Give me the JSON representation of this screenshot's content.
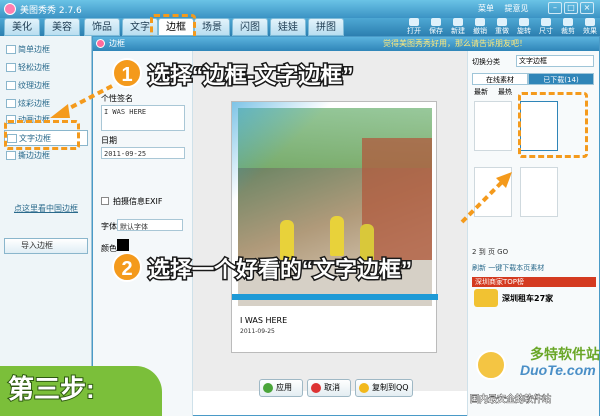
{
  "app": {
    "title": "美图秀秀 2.7.6",
    "top_links": [
      "菜单",
      "提意见"
    ]
  },
  "nav": {
    "tabs": [
      "美化",
      "美容",
      "饰品",
      "文字",
      "边框",
      "场景",
      "闪图",
      "娃娃",
      "拼图"
    ],
    "active": "边框"
  },
  "toolbar": {
    "tools": [
      "打开",
      "保存",
      "新建",
      "撤销",
      "重做",
      "旋转",
      "尺寸",
      "裁剪",
      "效果"
    ]
  },
  "sidebar": {
    "items": [
      "简单边框",
      "轻松边框",
      "纹理边框",
      "炫彩边框",
      "动画边框",
      "文字边框",
      "撕边边框"
    ],
    "selected": "文字边框",
    "link": "点这里看中国边框",
    "import_label": "导入边框"
  },
  "dialog": {
    "title": "边框",
    "promo": "觉得美图秀秀好用，那么请告诉朋友吧！",
    "signature_label": "个性签名",
    "signature_value": "I WAS HERE",
    "date_label": "日期",
    "date_value": "2011-09-25",
    "exif_label": "拍摄信息EXIF",
    "font_label": "字体",
    "font_value": "默认字体",
    "color_label": "颜色"
  },
  "frame": {
    "caption": "I WAS HERE",
    "date": "2011-09-25"
  },
  "right_panel": {
    "category_label": "切换分类",
    "category_value": "文字边框",
    "tabs": [
      "在线素材",
      "已下载(14)"
    ],
    "subtabs": [
      "最新",
      "最热"
    ],
    "pager": {
      "current": "2",
      "total_label": "页",
      "go": "GO",
      "to": "到"
    },
    "refresh": "刷新",
    "download_more": "一键下载本页素材",
    "ad_bar": "深圳商家TOP榜",
    "ad_text": "深圳租车27家"
  },
  "buttons": {
    "apply": "应用",
    "cancel": "取消",
    "copy_to_qq": "复制到QQ"
  },
  "overlay": {
    "step1_num": "1",
    "step1_text": "选择“边框-文字边框”",
    "step2_num": "2",
    "step2_text": "选择一个好看的“文字边框”",
    "step_badge": "第三步:",
    "watermark_site": "多特软件站",
    "watermark_domain": "DuoTe.com",
    "watermark_slogan": "国内最安全的软件站"
  },
  "colors": {
    "accent": "#f49a1c",
    "badge_green": "#7bbf3a",
    "nav_blue": "#2c7fb0"
  }
}
